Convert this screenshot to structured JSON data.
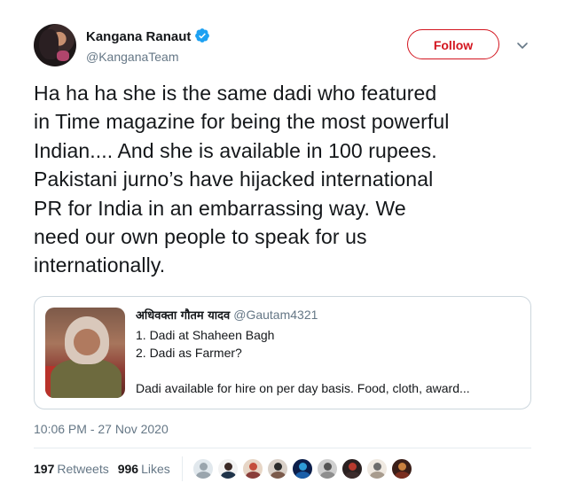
{
  "author": {
    "display_name": "Kangana Ranaut",
    "handle": "@KanganaTeam",
    "verified": true,
    "avatar_icon": "profile-photo"
  },
  "actions": {
    "follow_label": "Follow",
    "caret_icon": "chevron-down-icon"
  },
  "tweet": {
    "text_lines": [
      "Ha ha ha she is the same dadi who featured",
      "in Time magazine for being the most powerful",
      "Indian.... And she is available in 100 rupees.",
      "Pakistani jurno’s have hijacked international",
      "PR for India in an embarrassing way. We",
      "need our own people to speak for us",
      "internationally."
    ],
    "timestamp": "10:06 PM - 27 Nov 2020"
  },
  "quoted_tweet": {
    "author_name": "अधिवक्ता गौतम यादव",
    "author_handle": "@Gautam4321",
    "lines": [
      "1. Dadi at Shaheen Bagh",
      "2. Dadi as Farmer?",
      "",
      "Dadi available for hire on per day basis. Food, cloth, award..."
    ],
    "media_icon": "quoted-photo-thumbnail"
  },
  "stats": {
    "retweets_count": "197",
    "retweets_label": "Retweets",
    "likes_count": "996",
    "likes_label": "Likes"
  },
  "likers": [
    {
      "name": "liker-avatar-1",
      "bg": "#e1e8ed",
      "head": "#9aa5ad",
      "body": "#9aa5ad"
    },
    {
      "name": "liker-avatar-2",
      "bg": "#f2f2f2",
      "head": "#3b2a26",
      "body": "#1f3349"
    },
    {
      "name": "liker-avatar-3",
      "bg": "#e7d6c6",
      "head": "#c44e3b",
      "body": "#8a3e3a"
    },
    {
      "name": "liker-avatar-4",
      "bg": "#d9d0c8",
      "head": "#2b2b2b",
      "body": "#7b5b4c"
    },
    {
      "name": "liker-avatar-5",
      "bg": "#0b1e4a",
      "head": "#2e9bd6",
      "body": "#1a5ea8"
    },
    {
      "name": "liker-avatar-6",
      "bg": "#cfcfcf",
      "head": "#555555",
      "body": "#8e8e8e"
    },
    {
      "name": "liker-avatar-7",
      "bg": "#2a2020",
      "head": "#b63a2e",
      "body": "#3b2b2b"
    },
    {
      "name": "liker-avatar-8",
      "bg": "#efe9e1",
      "head": "#6d6d6d",
      "body": "#a89c8e"
    },
    {
      "name": "liker-avatar-9",
      "bg": "#3a1e18",
      "head": "#c9803f",
      "body": "#7a2e1f"
    }
  ],
  "colors": {
    "follow_accent": "#d3151f",
    "verified_blue": "#1da1f2",
    "secondary_text": "#657786",
    "border": "#ccd6dd"
  }
}
